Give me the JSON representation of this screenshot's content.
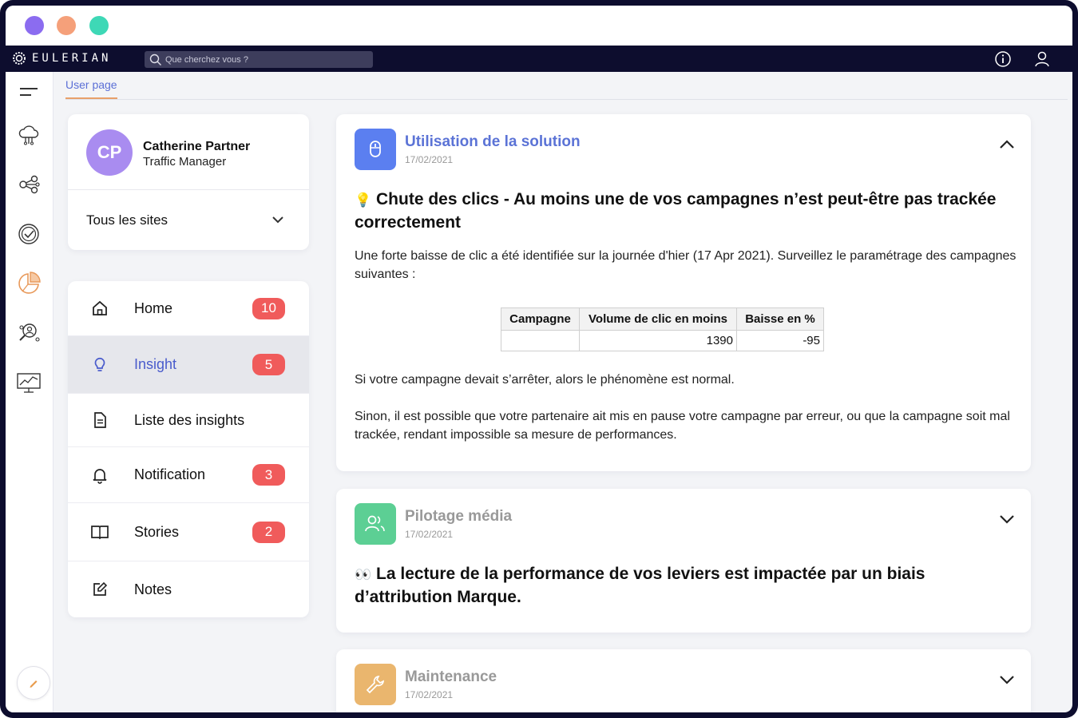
{
  "window": {
    "dot_colors": [
      "#8b6cf0",
      "#f5a07a",
      "#3ed8b6"
    ]
  },
  "topnav": {
    "logo_text": "EULERIAN",
    "search_placeholder": "Que cherchez vous ?",
    "icons": [
      "info-icon",
      "user-icon"
    ]
  },
  "sidebar": {
    "icons": [
      "menu-icon",
      "cloud-network-icon",
      "share-nodes-icon",
      "target-check-icon",
      "pie-chart-icon",
      "search-people-icon",
      "analytics-board-icon",
      "pencil-icon"
    ]
  },
  "tabs": {
    "active": "User page"
  },
  "profile": {
    "initials": "CP",
    "name": "Catherine Partner",
    "role": "Traffic Manager",
    "site_selector": "Tous les sites"
  },
  "menu": {
    "items": [
      {
        "label": "Home",
        "icon": "home-icon",
        "badge": "10"
      },
      {
        "label": "Insight",
        "icon": "lightbulb-icon",
        "badge": "5",
        "active": true
      },
      {
        "label": "Liste des insights",
        "icon": "document-icon",
        "badge": ""
      },
      {
        "label": "Notification",
        "icon": "bell-icon",
        "badge": "3"
      },
      {
        "label": "Stories",
        "icon": "book-icon",
        "badge": "2"
      },
      {
        "label": "Notes",
        "icon": "edit-icon",
        "badge": ""
      }
    ]
  },
  "insights": [
    {
      "category": "Utilisation de la solution",
      "date": "17/02/2021",
      "icon": "mouse-icon",
      "color": "#5b7ff0",
      "emoji": "💡",
      "title": "Chute des clics - Au moins une de vos campagnes n’est peut-être pas trackée correctement",
      "intro": "Une forte baisse de clic a été identifiée sur la journée d'hier (17 Apr 2021). Surveillez le paramétrage des campagnes suivantes :",
      "table": {
        "headers": [
          "Campagne",
          "Volume de clic en moins",
          "Baisse en %"
        ],
        "rows": [
          [
            "",
            "1390",
            "-95"
          ]
        ]
      },
      "p1": "Si votre campagne devait s’arrêter, alors le phénomène est normal.",
      "p2": "Sinon, il est possible que votre partenaire ait mis en pause votre campagne par erreur, ou que la campagne soit mal trackée, rendant impossible sa mesure de performances.",
      "expanded": true
    },
    {
      "category": "Pilotage média",
      "date": "17/02/2021",
      "icon": "users-icon",
      "color": "#5ccf94",
      "emoji": "👀",
      "title": "La lecture de la performance de vos leviers est impactée par un biais d’attribution Marque.",
      "expanded": false
    },
    {
      "category": "Maintenance",
      "date": "17/02/2021",
      "icon": "wrench-icon",
      "color": "#eab66e",
      "expanded": false
    }
  ]
}
